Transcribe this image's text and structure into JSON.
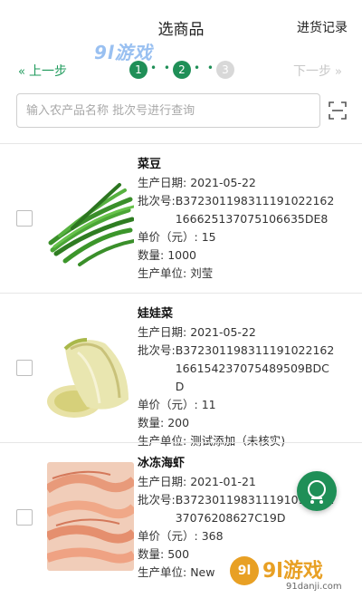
{
  "header": {
    "title": "选商品",
    "record_link": "进货记录"
  },
  "steps": {
    "prev_label": "上一步",
    "next_label": "下一步",
    "step1": "1",
    "step2": "2",
    "step3": "3",
    "dots": "• • •"
  },
  "search": {
    "placeholder": "输入农产品名称 批次号进行查询"
  },
  "products": [
    {
      "name": "菜豆",
      "date_label": "生产日期:",
      "date": "2021-05-22",
      "batch_label": "批次号:",
      "batch": "B372301198311191022162166625137075106635DE8",
      "price_label": "单价（元）:",
      "price": "15",
      "qty_label": "数量:",
      "qty": "1000",
      "unit_label": "生产单位:",
      "unit": "刘莹"
    },
    {
      "name": "娃娃菜",
      "date_label": "生产日期:",
      "date": "2021-05-22",
      "batch_label": "批次号:",
      "batch": "B372301198311191022162166154237075489509BDCD",
      "price_label": "单价（元）:",
      "price": "11",
      "qty_label": "数量:",
      "qty": "200",
      "unit_label": "生产单位:",
      "unit": "测试添加（未核实)"
    },
    {
      "name": "冰冻海虾",
      "date_label": "生产日期:",
      "date": "2021-01-21",
      "batch_label": "批次号:",
      "batch": "B37230119831119109031237076208627C19D",
      "price_label": "单价（元）:",
      "price": "368",
      "qty_label": "数量:",
      "qty": "500",
      "unit_label": "生产单位:",
      "unit": "New"
    }
  ],
  "watermark": {
    "logo": "9l游戏",
    "badge": "9l",
    "text": "9l游戏",
    "site": "91danji.com"
  },
  "colors": {
    "accent": "#1f8f57",
    "disabled": "#c8c8c8",
    "border": "#cfcfcf"
  }
}
